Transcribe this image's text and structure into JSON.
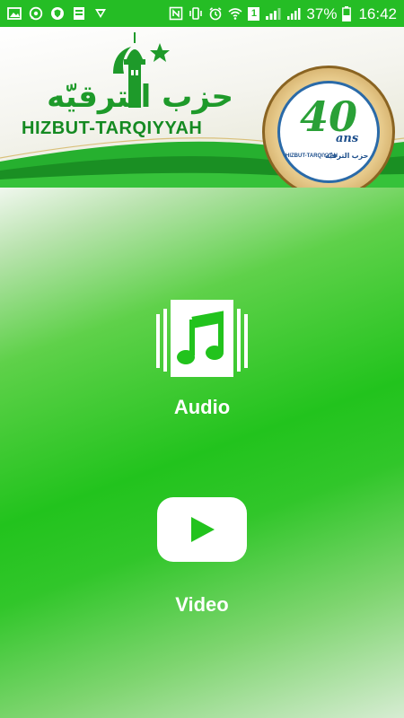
{
  "status_bar": {
    "battery": "37%",
    "time": "16:42",
    "sim": "1"
  },
  "banner": {
    "arabic_name": "حزب الترقيّه",
    "latin_name": "HIZBUT-TARQIYYAH",
    "badge_number": "40",
    "badge_suffix": "ans",
    "badge_latin": "HIZBUT-TARQIYYAH",
    "badge_arabic": "حزب الترقيّه"
  },
  "menu": {
    "audio_label": "Audio",
    "video_label": "Video"
  },
  "icons": {
    "audio": "music-note-icon",
    "video": "play-icon"
  },
  "colors": {
    "status_bar": "#25bd25",
    "brand_green": "#1e9a2a",
    "main_green": "#22c31d"
  }
}
